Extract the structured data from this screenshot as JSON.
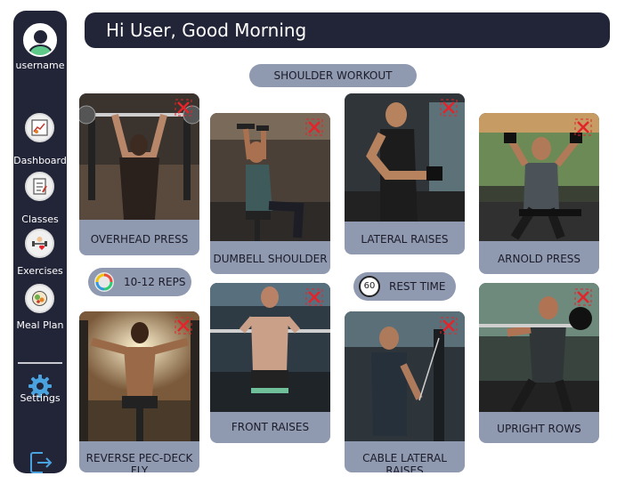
{
  "header": {
    "greeting": "Hi User, Good Morning"
  },
  "sidebar": {
    "username": "username",
    "items": [
      {
        "label": "Dashboard",
        "icon": "dashboard-icon"
      },
      {
        "label": "Classes",
        "icon": "classes-icon"
      },
      {
        "label": "Exercises",
        "icon": "exercises-icon"
      },
      {
        "label": "Meal Plan",
        "icon": "meal-plan-icon"
      }
    ],
    "settings_label": "Settings"
  },
  "workout": {
    "title": "SHOULDER WORKOUT"
  },
  "info": {
    "reps": "10-12 REPS",
    "rest": "REST TIME",
    "rest_icon_text": "60"
  },
  "exercises": [
    {
      "name": "OVERHEAD  PRESS"
    },
    {
      "name": "DUMBELL SHOULDER"
    },
    {
      "name": "LATERAL RAISES"
    },
    {
      "name": "ARNOLD PRESS"
    },
    {
      "name": "REVERSE PEC-DECK FLY"
    },
    {
      "name": "FRONT RAISES"
    },
    {
      "name": "CABLE LATERAL RAISES"
    },
    {
      "name": "UPRIGHT ROWS"
    }
  ],
  "colors": {
    "navy": "#222438",
    "pill": "#8f99b0",
    "accent_red": "#e3242b"
  }
}
